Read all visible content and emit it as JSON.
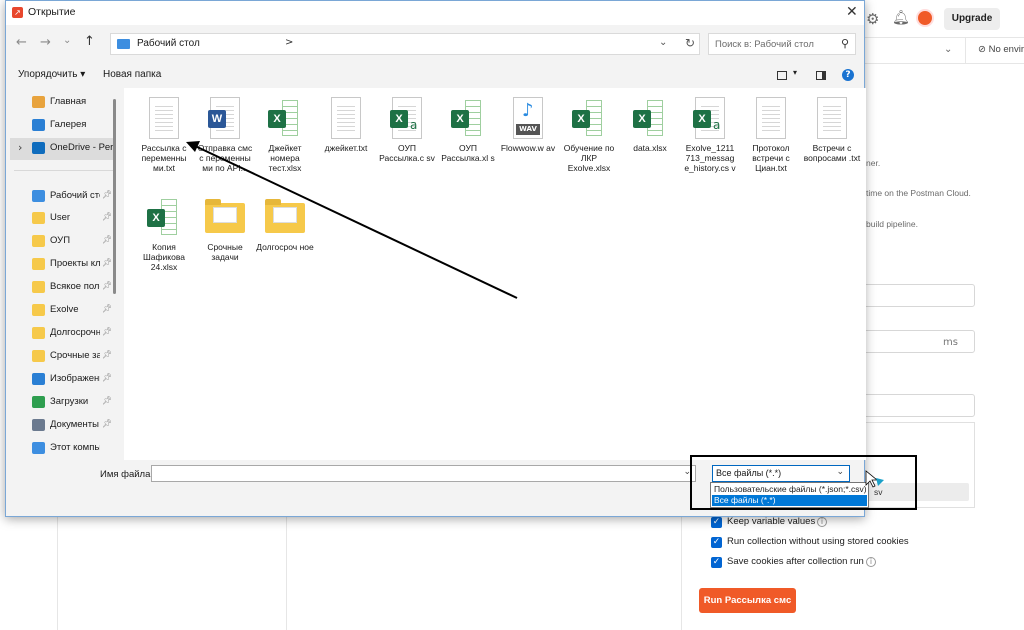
{
  "postman": {
    "upgrade_label": "Upgrade",
    "env_label": "No envir",
    "texts": [
      "ner.",
      "time on the Postman Cloud.",
      "build pipeline."
    ],
    "delay_unit": "ms",
    "behind_dropdown_text": "sv",
    "checkboxes": [
      {
        "label": "Keep variable values",
        "checked": true,
        "info": true
      },
      {
        "label": "Run collection without using stored cookies",
        "checked": true,
        "info": false
      },
      {
        "label": "Save cookies after collection run",
        "checked": true,
        "info": true
      }
    ],
    "run_button_label": "Run Рассылка смс"
  },
  "dialog": {
    "title": "Открытие",
    "address": "Рабочий стол",
    "address_chevron": ">",
    "search_placeholder": "Поиск в: Рабочий стол",
    "organize_label": "Упорядочить ▾",
    "new_folder_label": "Новая папка",
    "help_label": "?",
    "nav_items": [
      {
        "label": "Главная",
        "icon": "home-icon",
        "color": "#e8a33d",
        "pinned": false
      },
      {
        "label": "Галерея",
        "icon": "gallery-icon",
        "color": "#2a7fd4",
        "pinned": false
      },
      {
        "label": "OneDrive - Perso",
        "icon": "onedrive-icon",
        "color": "#0f6cbd",
        "pinned": false,
        "selected": true
      },
      {
        "label": "Рабочий сто",
        "icon": "desktop-icon",
        "color": "#3d8ee0",
        "pinned": true
      },
      {
        "label": "User",
        "icon": "folder-icon",
        "color": "#f6c94a",
        "pinned": true
      },
      {
        "label": "ОУП",
        "icon": "folder-icon",
        "color": "#f6c94a",
        "pinned": true
      },
      {
        "label": "Проекты кли",
        "icon": "folder-icon",
        "color": "#f6c94a",
        "pinned": true
      },
      {
        "label": "Всякое поле",
        "icon": "folder-icon",
        "color": "#f6c94a",
        "pinned": true
      },
      {
        "label": "Exolve",
        "icon": "folder-icon",
        "color": "#f6c94a",
        "pinned": true
      },
      {
        "label": "Долгосрочн",
        "icon": "folder-icon",
        "color": "#f6c94a",
        "pinned": true
      },
      {
        "label": "Срочные за",
        "icon": "folder-icon",
        "color": "#f6c94a",
        "pinned": true
      },
      {
        "label": "Изображени",
        "icon": "pictures-icon",
        "color": "#2a7fd4",
        "pinned": true
      },
      {
        "label": "Загрузки",
        "icon": "downloads-icon",
        "color": "#2e9e4f",
        "pinned": true
      },
      {
        "label": "Документы",
        "icon": "documents-icon",
        "color": "#6b7a8f",
        "pinned": true
      },
      {
        "label": "Этот компью",
        "icon": "computer-icon",
        "color": "#3d8ee0",
        "pinned": false
      }
    ],
    "files": [
      {
        "name": "Рассылка с переменны ми.txt",
        "type": "txt"
      },
      {
        "name": "Отправка смс с переменны ми по API...",
        "type": "docx"
      },
      {
        "name": "Джейкет номера тест.xlsx",
        "type": "xlsx"
      },
      {
        "name": "джейкет.txt",
        "type": "txt"
      },
      {
        "name": "ОУП Рассылка.c sv",
        "type": "csv"
      },
      {
        "name": "ОУП Рассылка.xl s",
        "type": "xls"
      },
      {
        "name": "Flowwow.w av",
        "type": "wav"
      },
      {
        "name": "Обучение по ЛКР Exolve.xlsx",
        "type": "xlsx"
      },
      {
        "name": "data.xlsx",
        "type": "xlsx"
      },
      {
        "name": "Exolve_1211 713_messag e_history.cs v",
        "type": "csv"
      },
      {
        "name": "Протокол встречи с Циан.txt",
        "type": "txt"
      },
      {
        "name": "Встречи с вопросами .txt",
        "type": "txt"
      },
      {
        "name": "Копия Шафикова 24.xlsx",
        "type": "xlsx"
      },
      {
        "name": "Срочные задачи",
        "type": "folder"
      },
      {
        "name": "Долгосроч ное",
        "type": "folder"
      }
    ],
    "filename_label": "Имя файла:",
    "filename_value": "",
    "filetype_selected": "Все файлы (*.*)",
    "filetype_options": [
      "Пользовательские файлы (*.json;*.csv)",
      "Все файлы (*.*)"
    ],
    "filetype_highlighted": "Все файлы (*.*)"
  }
}
